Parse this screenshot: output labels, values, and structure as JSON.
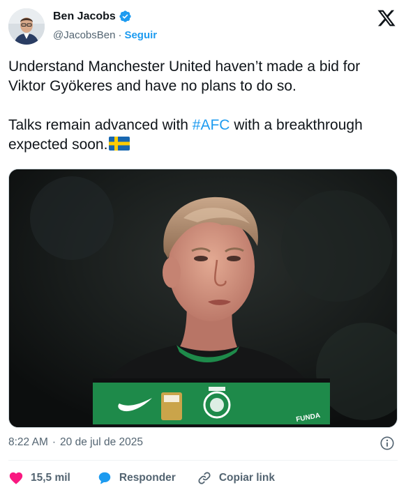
{
  "author": {
    "name": "Ben Jacobs",
    "handle": "@JacobsBen",
    "separator": "·",
    "follow_label": "Seguir",
    "verified_icon": "verified-badge-icon",
    "avatar": "avatar-photo"
  },
  "brand": {
    "logo_icon": "x-logo-icon"
  },
  "tweet": {
    "paragraph1": "Understand Manchester United haven’t made a bid for Viktor Gyökeres and have no plans to do so.",
    "paragraph2_before": "Talks remain advanced with ",
    "hashtag": "#AFC",
    "paragraph2_after": " with a breakthrough expected soon.",
    "flag_icon": "sweden-flag-emoji"
  },
  "media": {
    "type": "photo",
    "icon": "player-photo"
  },
  "meta": {
    "time": "8:22 AM",
    "separator": "·",
    "date": "20 de jul de 2025",
    "info_icon": "info-icon"
  },
  "actions": {
    "like_count": "15,5 mil",
    "reply_label": "Responder",
    "copy_link_label": "Copiar link"
  },
  "colors": {
    "accent": "#1d9bf0",
    "like": "#f91880",
    "text": "#0f1419",
    "secondary": "#536471",
    "jersey_green": "#1e8a4a"
  }
}
